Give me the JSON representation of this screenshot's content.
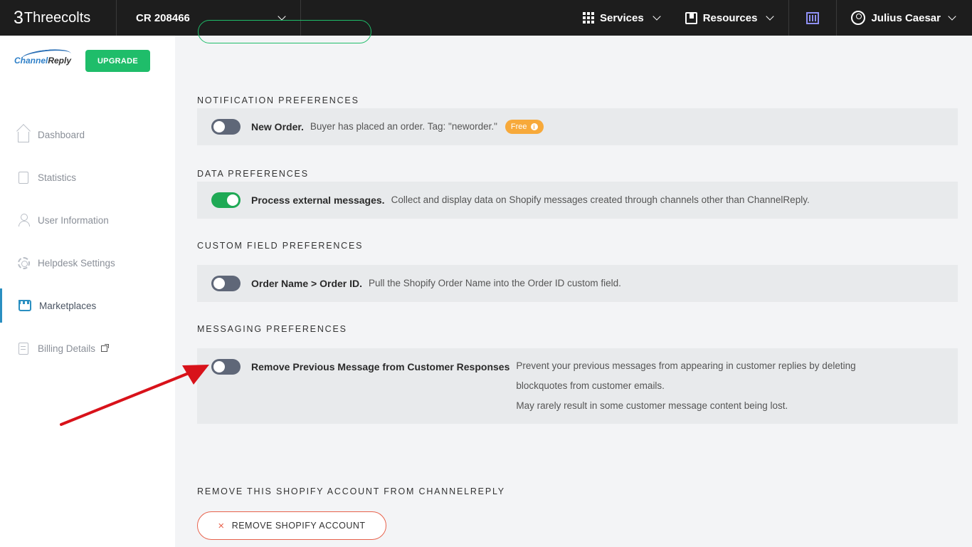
{
  "topbar": {
    "brand_logo": "3",
    "brand_name": "Threecolts",
    "account": "CR 208466",
    "services": "Services",
    "resources": "Resources",
    "user": "Julius Caesar"
  },
  "sidebar": {
    "logo_text_a": "Channel",
    "logo_text_b": "Reply",
    "upgrade": "UPGRADE",
    "items": [
      {
        "label": "Dashboard",
        "icon": "home-icon"
      },
      {
        "label": "Statistics",
        "icon": "clipboard-icon"
      },
      {
        "label": "User Information",
        "icon": "user-icon"
      },
      {
        "label": "Helpdesk Settings",
        "icon": "gear-icon"
      },
      {
        "label": "Marketplaces",
        "icon": "store-icon",
        "active": true
      },
      {
        "label": "Billing Details",
        "icon": "billing-icon"
      }
    ]
  },
  "sections": {
    "notification": {
      "title": "NOTIFICATION PREFERENCES",
      "name": "New Order.",
      "desc": "Buyer has placed an order. Tag: \"neworder.\"",
      "badge": "Free",
      "badge_info": "i",
      "enabled": false
    },
    "data": {
      "title": "DATA PREFERENCES",
      "name": "Process external messages.",
      "desc": "Collect and display data on Shopify messages created through channels other than ChannelReply.",
      "enabled": true
    },
    "custom": {
      "title": "CUSTOM FIELD PREFERENCES",
      "name": "Order Name > Order ID.",
      "desc": "Pull the Shopify Order Name into the Order ID custom field.",
      "enabled": false
    },
    "messaging": {
      "title": "MESSAGING PREFERENCES",
      "name": "Remove Previous Message from Customer Responses",
      "desc_line1": "Prevent your previous messages from appearing in customer replies by deleting",
      "desc_line2": "blockquotes from customer emails.",
      "desc_line3": "May rarely result in some customer message content being lost.",
      "enabled": false
    },
    "remove": {
      "title": "REMOVE THIS SHOPIFY ACCOUNT FROM CHANNELREPLY",
      "button": "REMOVE SHOPIFY ACCOUNT",
      "button_icon": "×"
    }
  },
  "colors": {
    "topbar": "#1d1d1d",
    "accent_green": "#1fbd6a",
    "active_blue": "#2a8fc1",
    "badge_orange": "#f7a93a",
    "remove_red": "#e8624c",
    "arrow_red": "#d8121a"
  }
}
